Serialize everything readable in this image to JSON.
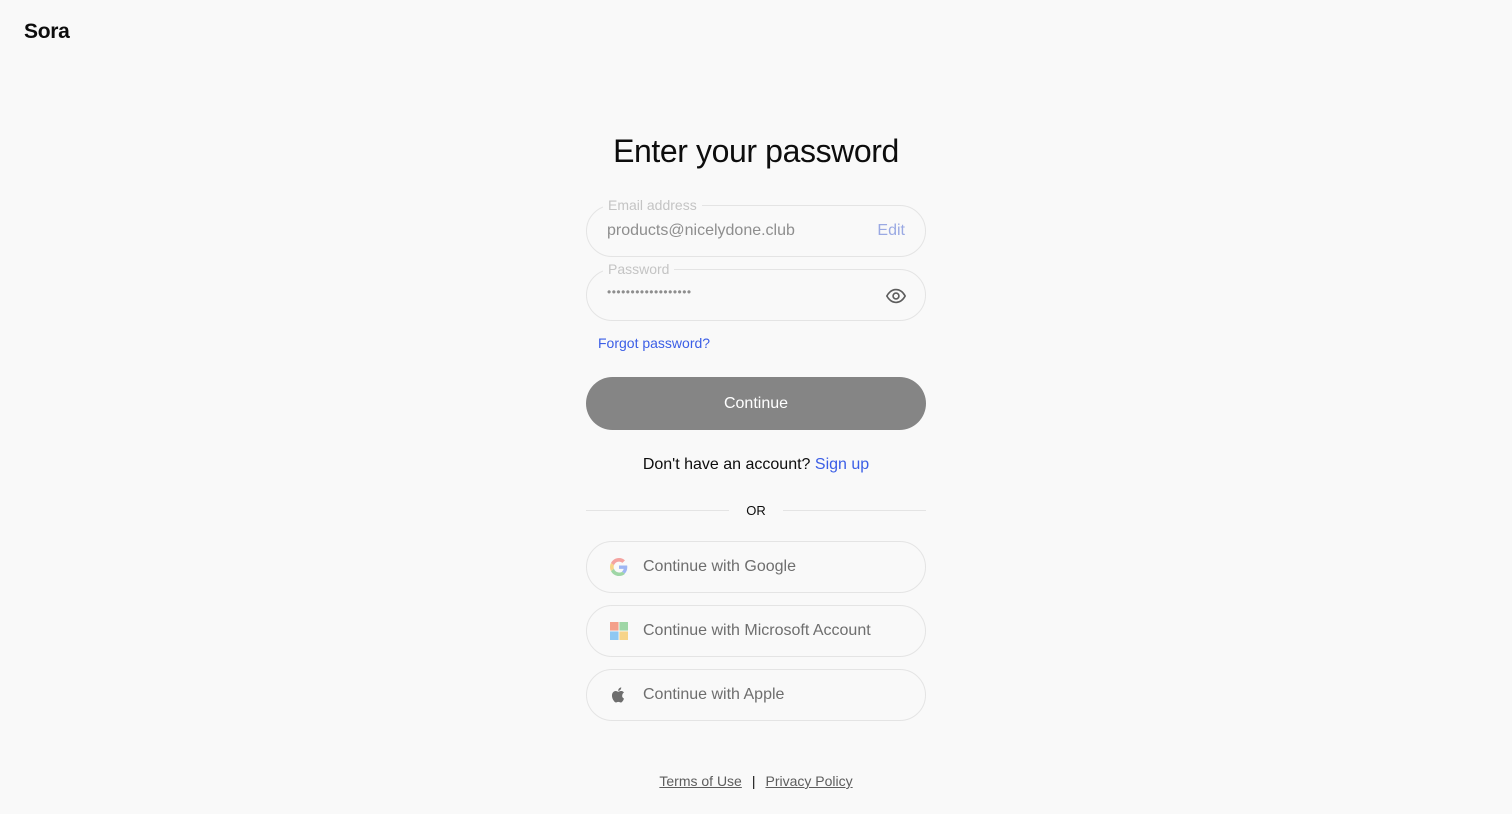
{
  "brand": {
    "name": "Sora"
  },
  "page": {
    "title": "Enter your password"
  },
  "email": {
    "label": "Email address",
    "value": "products@nicelydone.club",
    "edit_label": "Edit"
  },
  "password": {
    "label": "Password",
    "masked_value": "••••••••••••••••••",
    "toggle_icon": "eye-icon"
  },
  "forgot_label": "Forgot password?",
  "continue_label": "Continue",
  "signup": {
    "prompt": "Don't have an account?",
    "link_label": "Sign up"
  },
  "divider_label": "OR",
  "social": [
    {
      "icon": "google-icon",
      "label": "Continue with Google"
    },
    {
      "icon": "microsoft-icon",
      "label": "Continue with Microsoft Account"
    },
    {
      "icon": "apple-icon",
      "label": "Continue with Apple"
    }
  ],
  "footer": {
    "terms_label": "Terms of Use",
    "separator": "|",
    "privacy_label": "Privacy Policy"
  },
  "colors": {
    "background": "#f9f9f9",
    "link": "#3b5ee6",
    "button": "#858585",
    "border": "#e4e4e4"
  }
}
